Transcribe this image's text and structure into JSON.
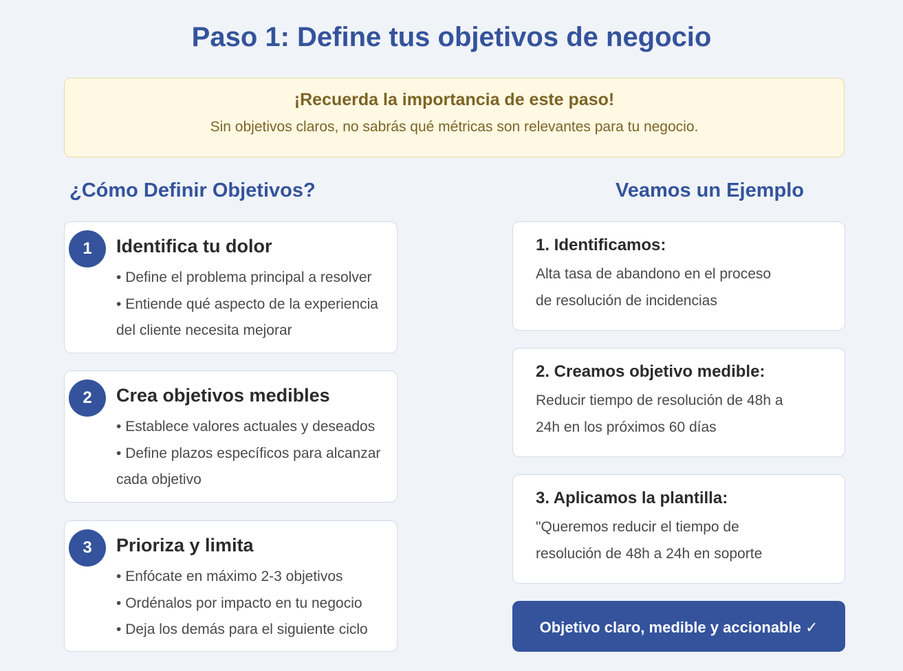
{
  "page": {
    "title": "Paso 1: Define tus objetivos de negocio"
  },
  "reminder": {
    "heading": "¡Recuerda la importancia de este paso!",
    "text": "Sin objetivos claros, no sabrás qué métricas son relevantes para tu negocio."
  },
  "how_to": {
    "heading": "¿Cómo Definir Objetivos?",
    "steps": [
      {
        "number": "1",
        "title": "Identifica tu dolor",
        "bullets": [
          "Define el problema principal a resolver",
          "Entiende qué aspecto de la experiencia del cliente necesita mejorar"
        ]
      },
      {
        "number": "2",
        "title": "Crea objetivos medibles",
        "bullets": [
          "Establece valores actuales y deseados",
          "Define plazos específicos para alcanzar cada objetivo"
        ]
      },
      {
        "number": "3",
        "title": "Prioriza y limita",
        "bullets": [
          "Enfócate en máximo 2-3 objetivos",
          "Ordénalos por impacto en tu negocio",
          "Deja los demás para el siguiente ciclo"
        ]
      }
    ]
  },
  "example": {
    "heading": "Veamos un Ejemplo",
    "cards": [
      {
        "title": "1. Identificamos:",
        "text": "Alta tasa de abandono en el proceso de resolución de incidencias"
      },
      {
        "title": "2. Creamos objetivo medible:",
        "text": "Reducir tiempo de resolución de 48h a 24h en los próximos 60 días"
      },
      {
        "title": "3. Aplicamos la plantilla:",
        "text": "\"Queremos reducir el tiempo de resolución de 48h a 24h en soporte"
      }
    ],
    "result": "Objetivo claro, medible y accionable ✓"
  },
  "colors": {
    "primary": "#34539c",
    "background": "#f0f3f8",
    "reminder_bg": "#fff8e3",
    "reminder_text": "#7c6424"
  }
}
